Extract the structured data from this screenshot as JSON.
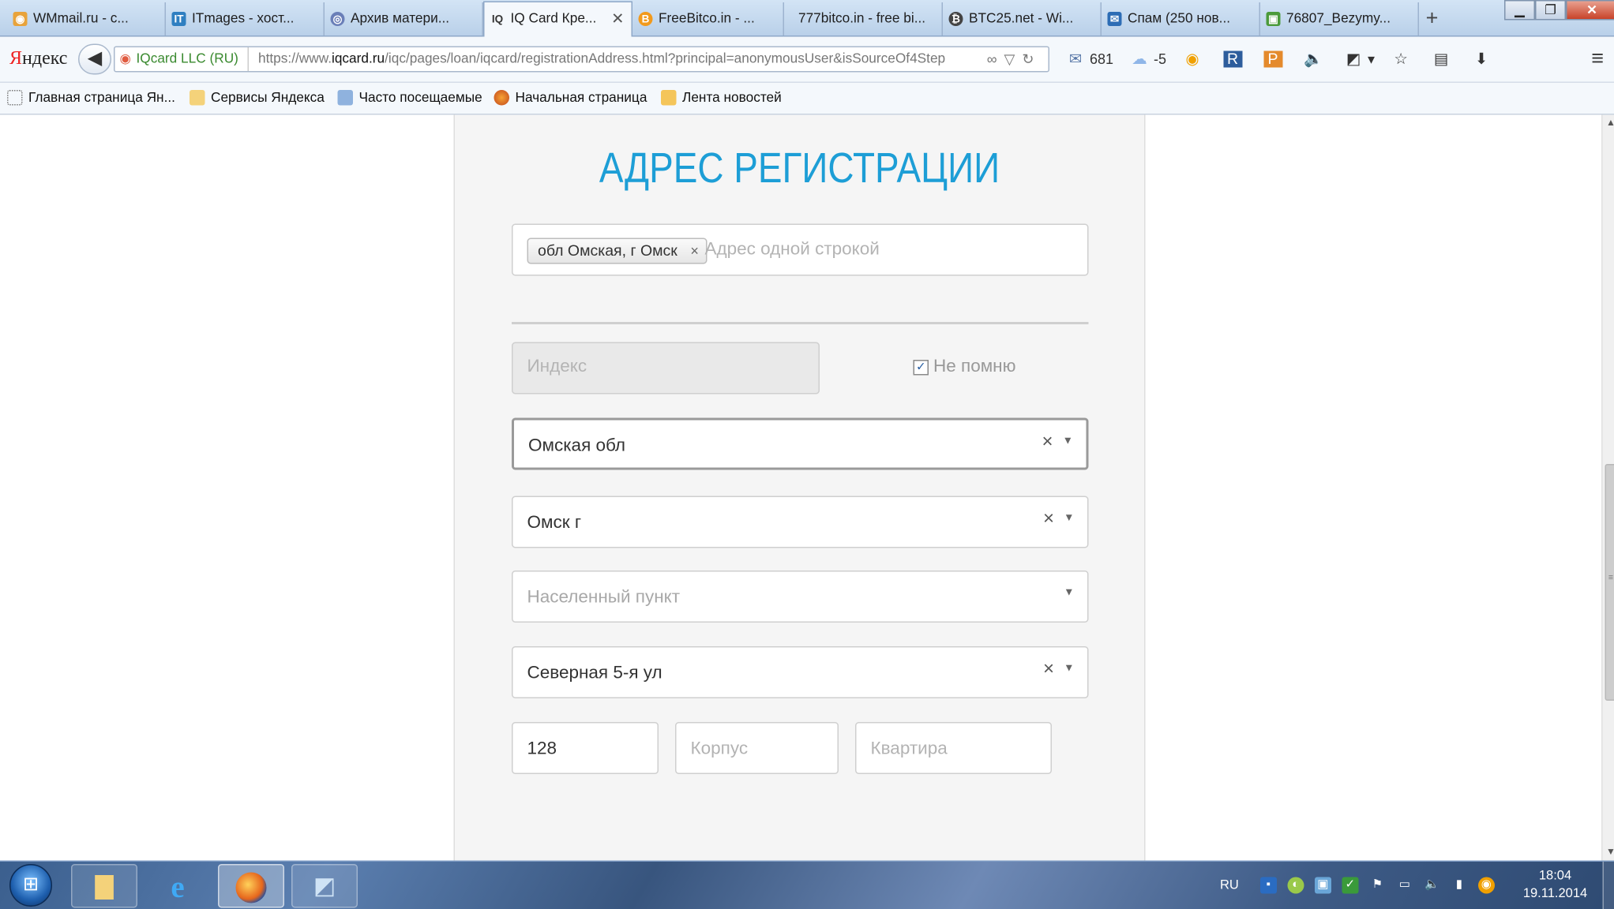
{
  "tabs": [
    {
      "label": "WMmail.ru - с...",
      "icon": "wmmail-icon",
      "color": "#e8a33b"
    },
    {
      "label": "ITmages - хост...",
      "icon": "itmages-icon",
      "color": "#2f7fc1"
    },
    {
      "label": "Архив матери...",
      "icon": "archive-icon",
      "color": "#6a7fb8"
    },
    {
      "label": "IQ Card Кре...",
      "icon": "iqcard-icon",
      "color": "#333333",
      "active": true
    },
    {
      "label": "FreeBitco.in - ...",
      "icon": "bitcoin-icon",
      "color": "#f29a1c"
    },
    {
      "label": "777bitco.in - free bi...",
      "icon": "",
      "color": ""
    },
    {
      "label": "BTC25.net - Wi...",
      "icon": "btc25-icon",
      "color": "#444444"
    },
    {
      "label": "Спам (250 нов...",
      "icon": "mail-icon",
      "color": "#2d6db5"
    },
    {
      "label": "76807_Bezymy...",
      "icon": "image-icon",
      "color": "#4b9a3a"
    }
  ],
  "browser": {
    "logo": "Яндекс",
    "identity": "IQcard LLC (RU)",
    "url_prefix": "https://www.",
    "url_domain": "iqcard.ru",
    "url_path": "/iqc/pages/loan/iqcard/registrationAddress.html?principal=anonymousUser&isSourceOf4Step",
    "mail_count": "681",
    "weather": "-5"
  },
  "bookmarks": [
    {
      "label": "Главная страница Ян...",
      "icon": "page-icon"
    },
    {
      "label": "Сервисы Яндекса",
      "icon": "folder-icon"
    },
    {
      "label": "Часто посещаемые",
      "icon": "smart-folder-icon"
    },
    {
      "label": "Начальная страница",
      "icon": "firefox-icon"
    },
    {
      "label": "Лента новостей",
      "icon": "rss-folder-icon"
    }
  ],
  "form": {
    "title": "АДРЕС РЕГИСТРАЦИИ",
    "address_chip": "обл Омская, г Омск",
    "address_placeholder": "Адрес одной строкой",
    "index_placeholder": "Индекс",
    "dont_remember_label": "Не помню",
    "dont_remember_checked": true,
    "region": "Омская обл",
    "city": "Омск г",
    "locality_placeholder": "Населенный пункт",
    "street": "Северная 5-я ул",
    "house": "128",
    "building_placeholder": "Корпус",
    "apartment_placeholder": "Квартира"
  },
  "taskbar": {
    "language": "RU",
    "time": "18:04",
    "date": "19.11.2014"
  },
  "colors": {
    "accent": "#1d9ed6"
  }
}
